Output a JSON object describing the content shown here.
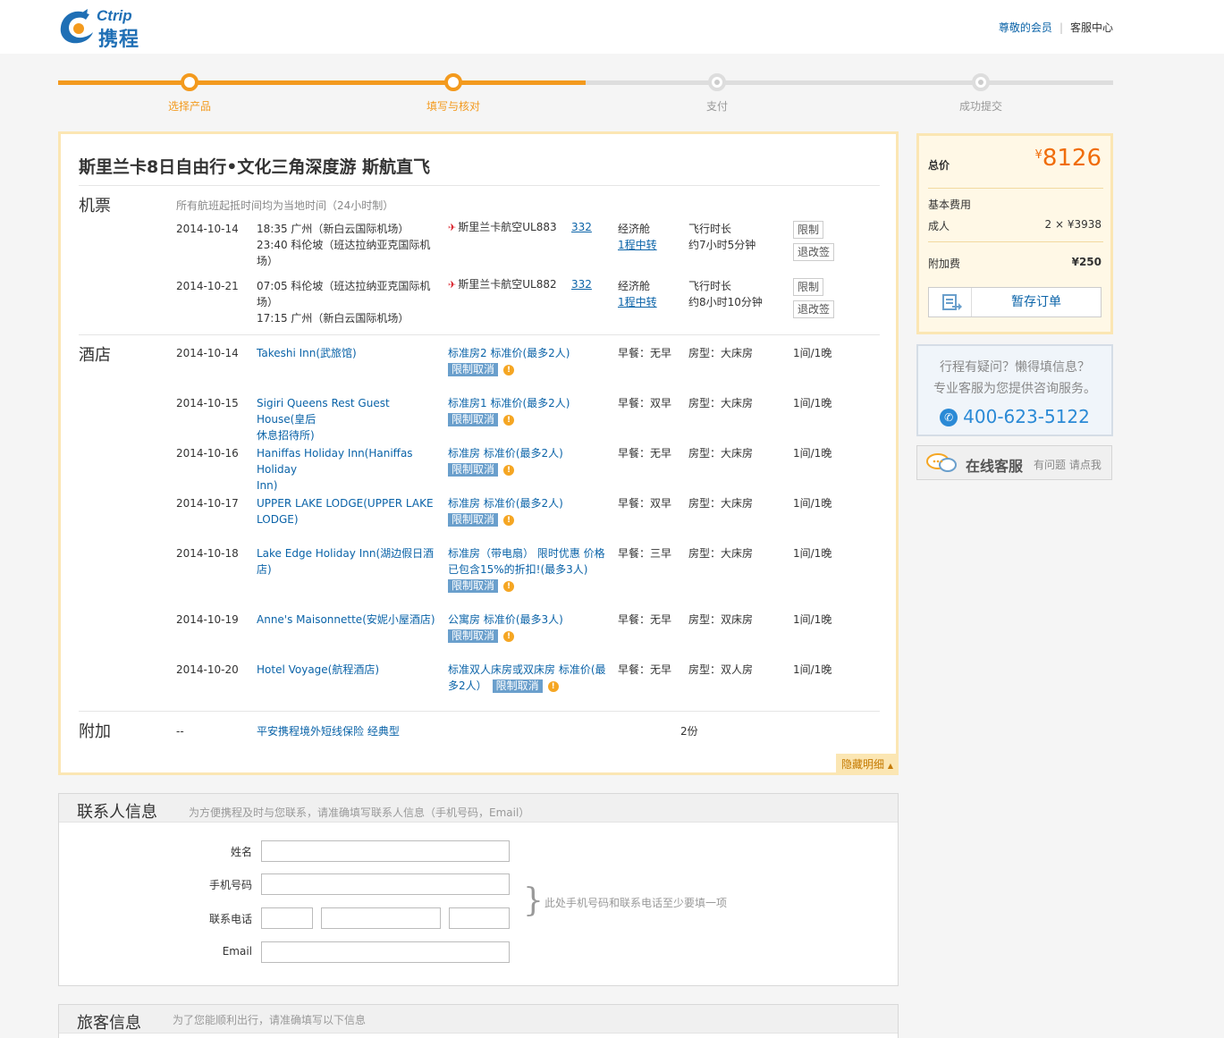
{
  "header": {
    "logo_en": "Ctrip",
    "logo_cn": "携程",
    "member_link": "尊敬的会员",
    "separator": "|",
    "service_link": "客服中心"
  },
  "steps": [
    {
      "label": "选择产品",
      "state": "done"
    },
    {
      "label": "填写与核对",
      "state": "current"
    },
    {
      "label": "支付",
      "state": "todo"
    },
    {
      "label": "成功提交",
      "state": "todo"
    }
  ],
  "detail": {
    "title": "斯里兰卡8日自由行•文化三角深度游 斯航直飞",
    "flight_section": "机票",
    "flight_note": "所有航班起抵时间均为当地时间（24小时制）",
    "flights": [
      {
        "date": "2014-10-14",
        "route_line1": "18:35 广州（新白云国际机场）",
        "route_line2": "23:40 科伦坡（班达拉纳亚克国际机",
        "route_line3": "场）",
        "airline": "斯里兰卡航空UL883",
        "aircraft": "332",
        "cabin": "经济舱",
        "transfer": "1程中转",
        "duration_label": "飞行时长",
        "duration": "约7小时5分钟",
        "btn_restrict": "限制",
        "btn_refund": "退改签"
      },
      {
        "date": "2014-10-21",
        "route_line1": "07:05 科伦坡（班达拉纳亚克国际机",
        "route_line2": "场）",
        "route_line3": "17:15 广州（新白云国际机场）",
        "airline": "斯里兰卡航空UL882",
        "aircraft": "332",
        "cabin": "经济舱",
        "transfer": "1程中转",
        "duration_label": "飞行时长",
        "duration": "约8小时10分钟",
        "btn_restrict": "限制",
        "btn_refund": "退改签"
      }
    ],
    "hotel_section": "酒店",
    "hotels": [
      {
        "date": "2014-10-14",
        "name1": "Takeshi Inn(武旅馆)",
        "name2": "",
        "room1": "标准房2 标准价(最多2人)",
        "room2": "",
        "cancel": "限制取消",
        "breakfast": "早餐：无早",
        "bed": "房型：大床房",
        "qty": "1间/1晚"
      },
      {
        "date": "2014-10-15",
        "name1": "Sigiri Queens Rest Guest House(皇后",
        "name2": "休息招待所)",
        "room1": "标准房1 标准价(最多2人)",
        "room2": "",
        "cancel": "限制取消",
        "breakfast": "早餐：双早",
        "bed": "房型：大床房",
        "qty": "1间/1晚"
      },
      {
        "date": "2014-10-16",
        "name1": "Haniffas Holiday Inn(Haniffas Holiday",
        "name2": "Inn)",
        "room1": "标准房 标准价(最多2人)",
        "room2": "",
        "cancel": "限制取消",
        "breakfast": "早餐：无早",
        "bed": "房型：大床房",
        "qty": "1间/1晚"
      },
      {
        "date": "2014-10-17",
        "name1": "UPPER LAKE LODGE(UPPER LAKE",
        "name2": "LODGE)",
        "room1": "标准房 标准价(最多2人)",
        "room2": "",
        "cancel": "限制取消",
        "breakfast": "早餐：双早",
        "bed": "房型：大床房",
        "qty": "1间/1晚"
      },
      {
        "date": "2014-10-18",
        "name1": "Lake Edge Holiday Inn(湖边假日酒店)",
        "name2": "",
        "room1": "标准房（带电扇） 限时优惠 价格",
        "room2": "已包含15%的折扣!(最多3人)",
        "cancel": "限制取消",
        "breakfast": "早餐：三早",
        "bed": "房型：大床房",
        "qty": "1间/1晚"
      },
      {
        "date": "2014-10-19",
        "name1": "Anne's Maisonnette(安妮小屋酒店)",
        "name2": "",
        "room1": "公寓房 标准价(最多3人)",
        "room2": "",
        "cancel": "限制取消",
        "breakfast": "早餐：无早",
        "bed": "房型：双床房",
        "qty": "1间/1晚"
      },
      {
        "date": "2014-10-20",
        "name1": "Hotel Voyage(航程酒店)",
        "name2": "",
        "room1": "标准双人床房或双床房 标准价(最",
        "room2": "多2人）",
        "cancel": "限制取消",
        "breakfast": "早餐：无早",
        "bed": "房型：双人房",
        "qty": "1间/1晚"
      }
    ],
    "extra_section": "附加",
    "extra": {
      "date": "--",
      "name": "平安携程境外短线保险 经典型",
      "qty": "2份"
    },
    "hide_detail": "隐藏明细"
  },
  "price_panel": {
    "total_label": "总价",
    "currency": "¥",
    "total": "8126",
    "base_label": "基本费用",
    "adult_label": "成人",
    "adult_value": "2 × ¥3938",
    "surcharge_label": "附加费",
    "surcharge_value": "¥250",
    "save_button": "暂存订单"
  },
  "help": {
    "line1": "行程有疑问？懒得填信息？",
    "line2": "专业客服为您提供咨询服务。",
    "phone": "400-623-5122"
  },
  "online": {
    "title": "在线客服",
    "subtitle": "有问题 请点我"
  },
  "contact": {
    "title": "联系人信息",
    "desc": "为方便携程及时与您联系，请准确填写联系人信息（手机号码，Email）",
    "name_label": "姓名",
    "mobile_label": "手机号码",
    "phone_label": "联系电话",
    "email_label": "Email",
    "hint": "此处手机号码和联系电话至少要填一项"
  },
  "traveler": {
    "title": "旅客信息",
    "desc": "为了您能顺利出行，请准确填写以下信息"
  },
  "colors": {
    "accent_orange": "#f39a1e",
    "price_orange": "#f06d0a",
    "link_blue": "#0a63a8",
    "panel_border": "#fbe6b3"
  }
}
